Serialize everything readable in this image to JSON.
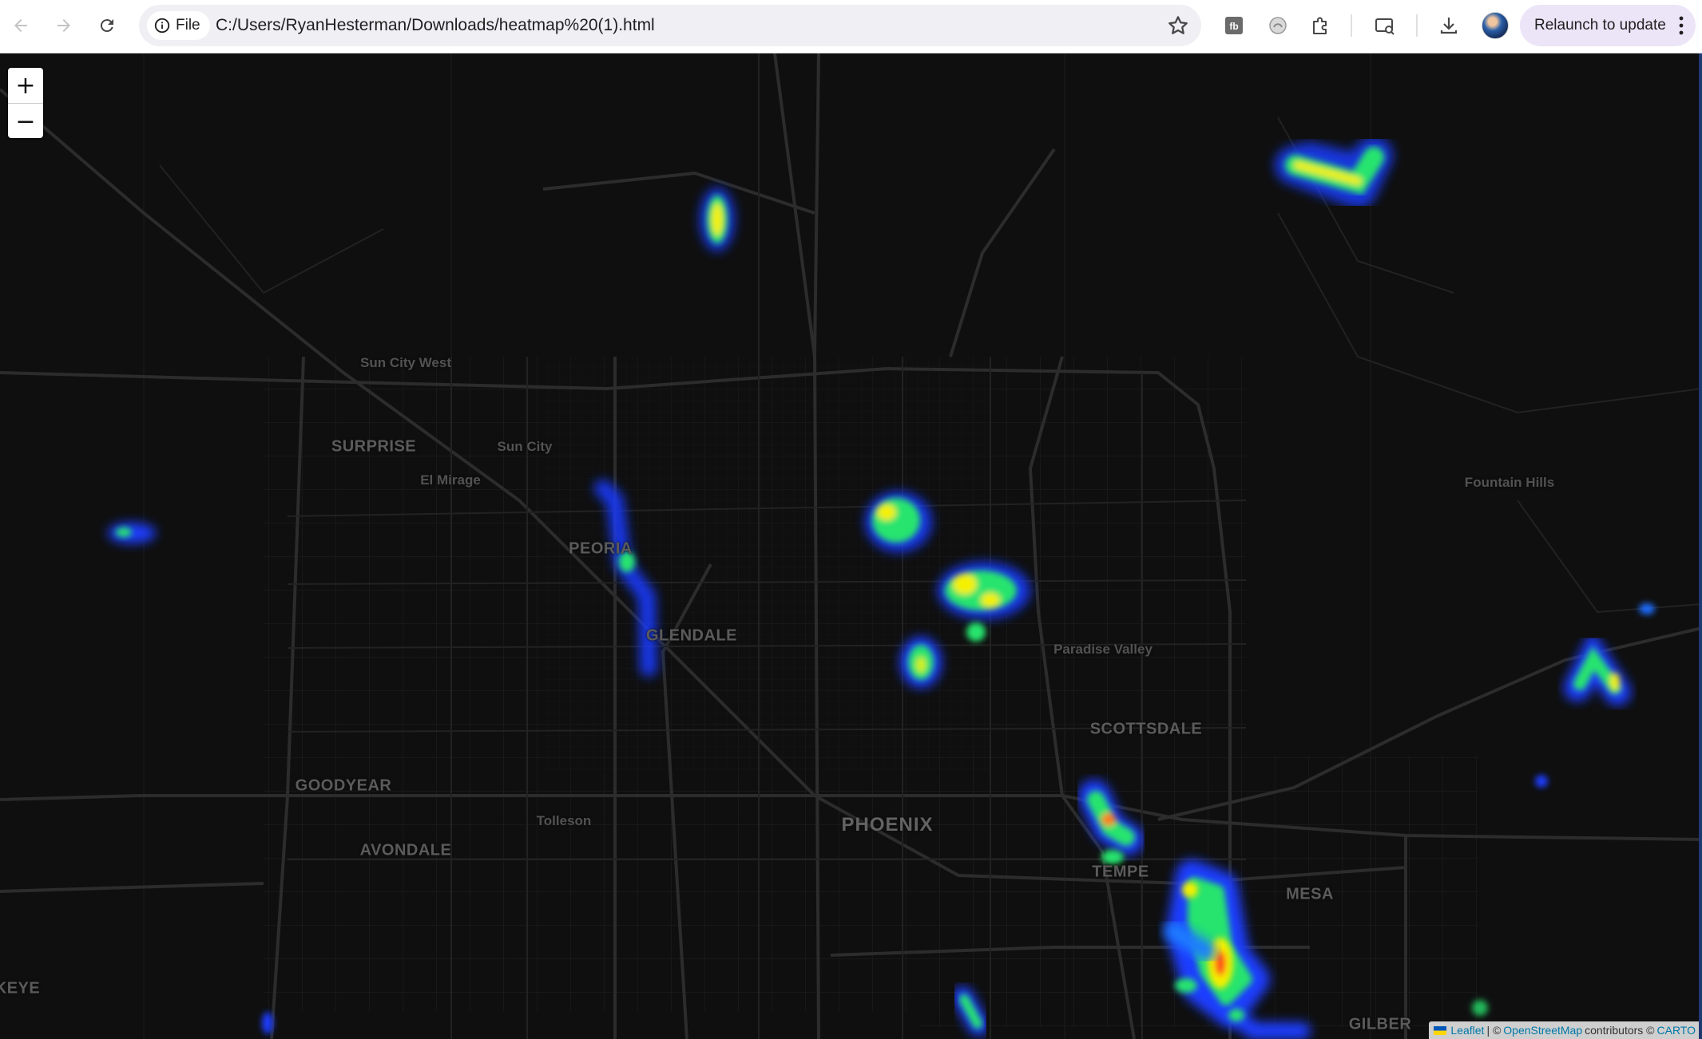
{
  "browser": {
    "site_chip_label": "File",
    "url": "C:/Users/RyanHesterman/Downloads/heatmap%20(1).html",
    "relaunch_label": "Relaunch to update",
    "colors": {
      "toolbar_bg": "#ffffff",
      "omnibox_bg": "#efeff4",
      "relaunch_bg": "#ece4f7"
    },
    "icons": [
      "back-arrow-icon",
      "forward-arrow-icon",
      "reload-icon",
      "info-icon",
      "star-icon",
      "extension-fb-icon",
      "extension-shield-icon",
      "puzzle-icon",
      "screen-search-icon",
      "download-icon",
      "profile-avatar",
      "more-vert-icon"
    ]
  },
  "map": {
    "basemap": "dark",
    "zoom_in_label": "+",
    "zoom_out_label": "−",
    "labels": {
      "sun_city_west": "Sun City West",
      "surprise": "SURPRISE",
      "sun_city": "Sun City",
      "el_mirage": "El Mirage",
      "peoria": "PEORIA",
      "glendale": "GLENDALE",
      "fountain_hills": "Fountain Hills",
      "paradise_valley": "Paradise Valley",
      "scottsdale": "SCOTTSDALE",
      "goodyear": "GOODYEAR",
      "tolleson": "Tolleson",
      "avondale": "AVONDALE",
      "phoenix": "PHOENIX",
      "tempe": "TEMPE",
      "mesa": "MESA",
      "buckeye_partial": "KEYE",
      "gilbert_partial": "GILBER"
    },
    "heat_gradient": {
      "low": "#1a3cff",
      "mid": "#25e46e",
      "high": "#f4f000",
      "peak": "#ff4a12"
    },
    "attribution": {
      "leaflet": "Leaflet",
      "separator": "| ©",
      "osm": "OpenStreetMap",
      "contributors": "contributors ©",
      "carto": "CARTO"
    }
  }
}
